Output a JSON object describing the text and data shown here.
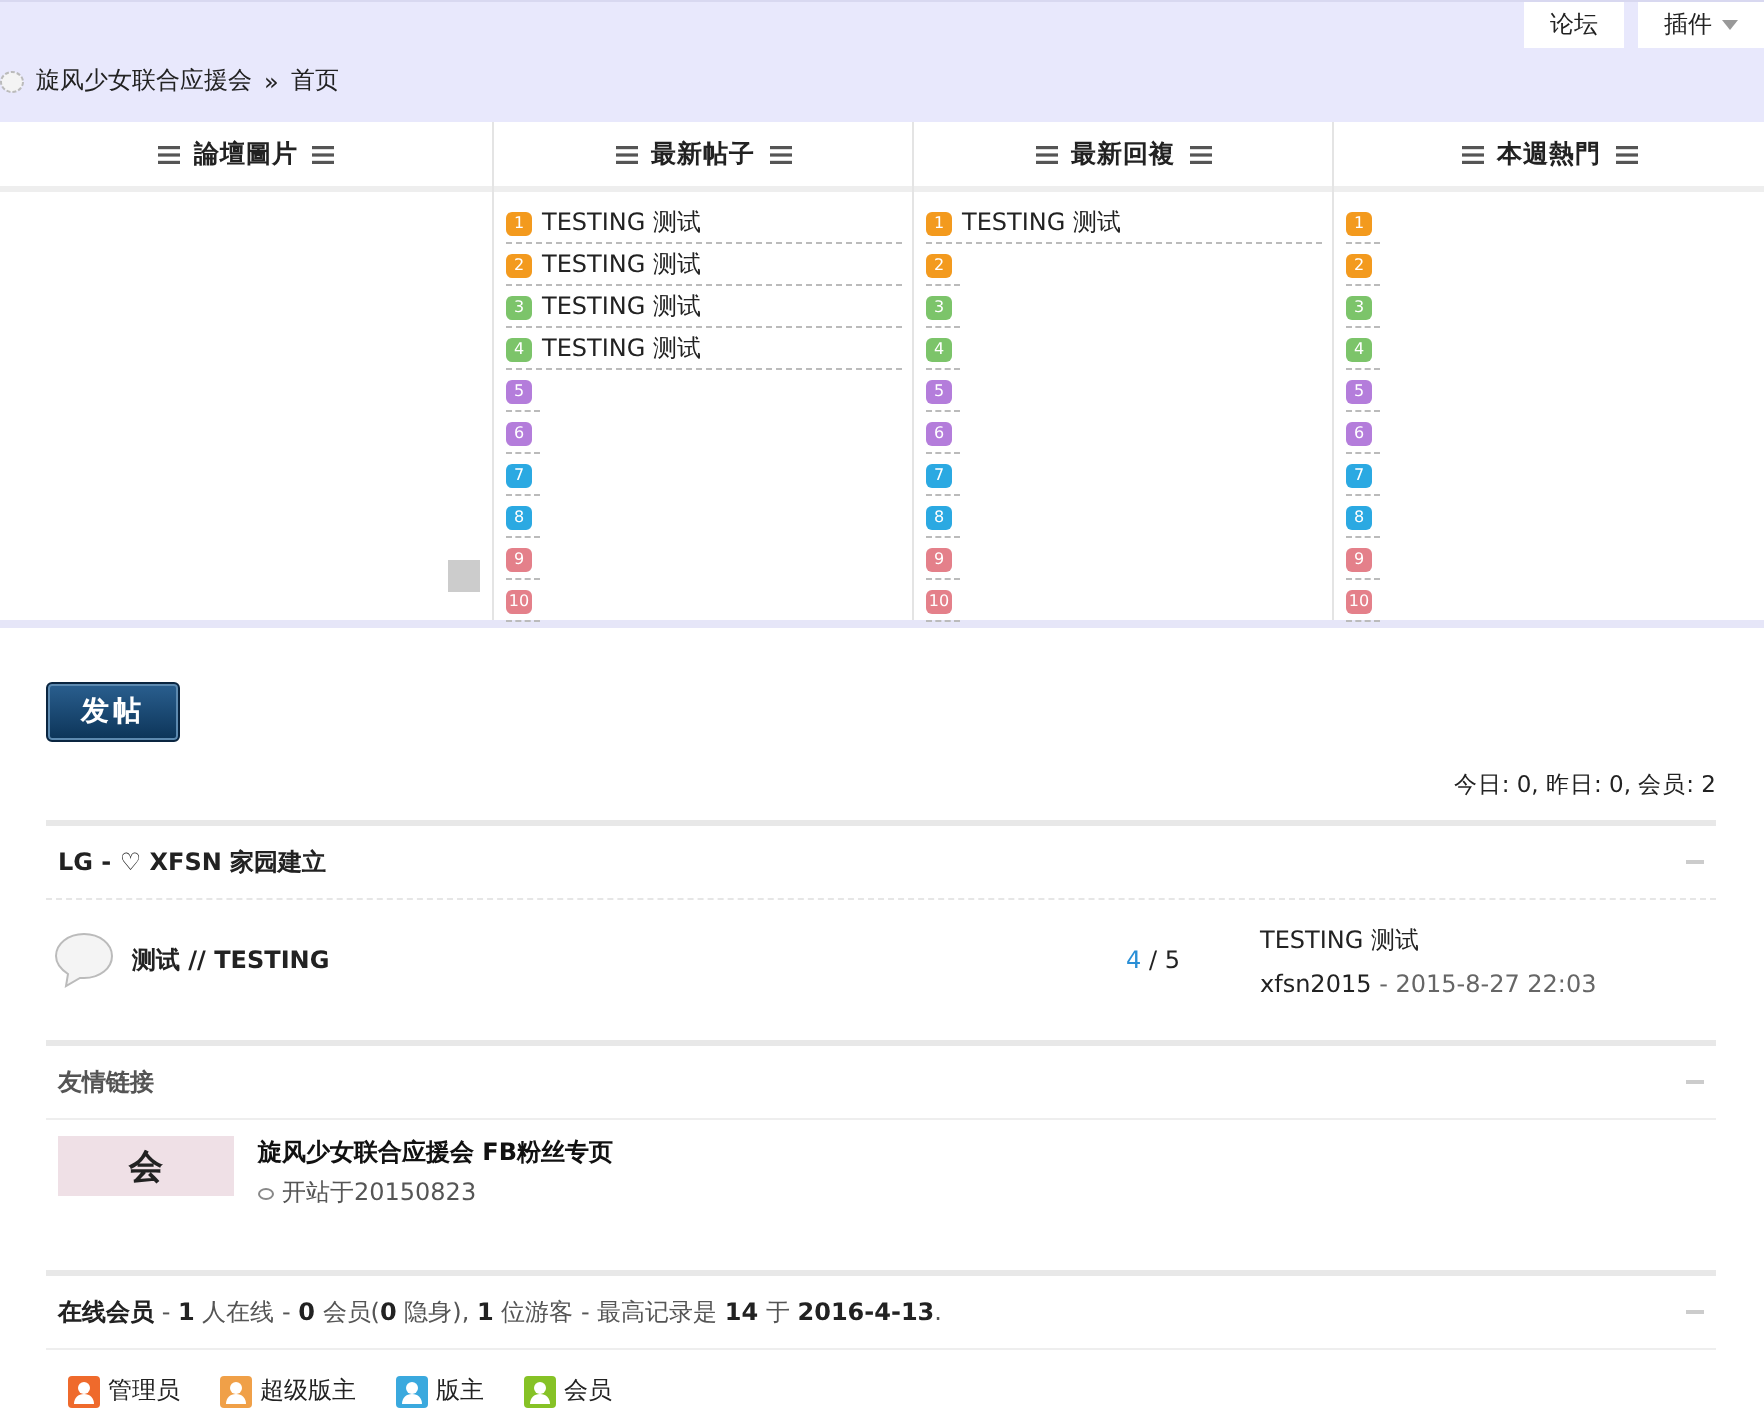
{
  "top_nav": [
    {
      "label": "论坛",
      "has_menu": false
    },
    {
      "label": "插件",
      "has_menu": true
    }
  ],
  "breadcrumb": {
    "site": "旋风少女联合应援会",
    "separator": "»",
    "current": "首页"
  },
  "columns": [
    {
      "kind": "images",
      "title": "論壇圖片"
    },
    {
      "kind": "list",
      "title": "最新帖子",
      "items": [
        {
          "rank": "1",
          "color": "#f39a1e",
          "title": "TESTING 测试"
        },
        {
          "rank": "2",
          "color": "#f39a1e",
          "title": "TESTING 测试"
        },
        {
          "rank": "3",
          "color": "#7cc46a",
          "title": "TESTING 测试"
        },
        {
          "rank": "4",
          "color": "#7cc46a",
          "title": "TESTING 测试"
        },
        {
          "rank": "5",
          "color": "#b47ddb"
        },
        {
          "rank": "6",
          "color": "#b47ddb"
        },
        {
          "rank": "7",
          "color": "#2ba9e2"
        },
        {
          "rank": "8",
          "color": "#2ba9e2"
        },
        {
          "rank": "9",
          "color": "#e4808a"
        },
        {
          "rank": "10",
          "color": "#e4808a"
        }
      ]
    },
    {
      "kind": "list",
      "title": "最新回複",
      "items": [
        {
          "rank": "1",
          "color": "#f39a1e",
          "title": "TESTING 测试"
        },
        {
          "rank": "2",
          "color": "#f39a1e"
        },
        {
          "rank": "3",
          "color": "#7cc46a"
        },
        {
          "rank": "4",
          "color": "#7cc46a"
        },
        {
          "rank": "5",
          "color": "#b47ddb"
        },
        {
          "rank": "6",
          "color": "#b47ddb"
        },
        {
          "rank": "7",
          "color": "#2ba9e2"
        },
        {
          "rank": "8",
          "color": "#2ba9e2"
        },
        {
          "rank": "9",
          "color": "#e4808a"
        },
        {
          "rank": "10",
          "color": "#e4808a"
        }
      ]
    },
    {
      "kind": "list",
      "title": "本週熱門",
      "items": [
        {
          "rank": "1",
          "color": "#f39a1e"
        },
        {
          "rank": "2",
          "color": "#f39a1e"
        },
        {
          "rank": "3",
          "color": "#7cc46a"
        },
        {
          "rank": "4",
          "color": "#7cc46a"
        },
        {
          "rank": "5",
          "color": "#b47ddb"
        },
        {
          "rank": "6",
          "color": "#b47ddb"
        },
        {
          "rank": "7",
          "color": "#2ba9e2"
        },
        {
          "rank": "8",
          "color": "#2ba9e2"
        },
        {
          "rank": "9",
          "color": "#e4808a"
        },
        {
          "rank": "10",
          "color": "#e4808a"
        }
      ]
    }
  ],
  "post_button": "发帖",
  "stats": "今日: 0, 昨日: 0, 会员: 2",
  "category": {
    "title": "LG - ♡ XFSN 家园建立",
    "forums": [
      {
        "name": "测试 // TESTING",
        "threads": "4",
        "count_separator": "/",
        "posts": "5",
        "last_post": "TESTING 测试",
        "last_author": "xfsn2015",
        "time_separator": "-",
        "last_time": "2015-8-27 22:03"
      }
    ]
  },
  "links": {
    "title": "友情链接",
    "items": [
      {
        "logo": "会",
        "name": "旋风少女联合应援会 FB粉丝专页",
        "description": "开站于20150823"
      }
    ]
  },
  "online": {
    "summary": "**在线会员** - **1** 人在线 - **0** 会员(**0** 隐身), **1** 位游客 - 最高记录是 **14** 于 **2016-4-13**.",
    "legend": [
      {
        "label": "管理员",
        "color": "#ef6a2c"
      },
      {
        "label": "超级版主",
        "color": "#f0a048"
      },
      {
        "label": "版主",
        "color": "#3aa9de"
      },
      {
        "label": "会员",
        "color": "#86c226"
      }
    ]
  }
}
